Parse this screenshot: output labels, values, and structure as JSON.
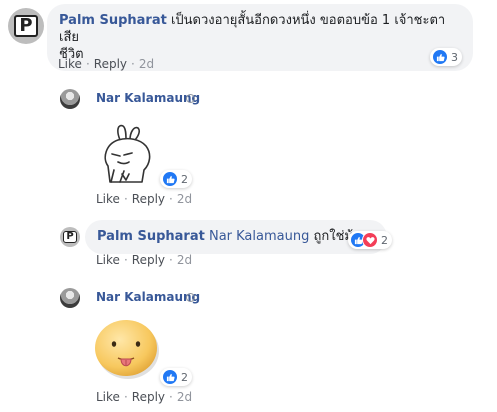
{
  "comments": [
    {
      "author": "Palm Supharat",
      "text_line1": "เป็นดวงอายุสั้นอีกดวงหนึ่ง ขอตอบข้อ 1 เจ้าชะตาเสีย",
      "text_line2": "ชีวิต",
      "like_label": "Like",
      "reply_label": "Reply",
      "time": "2d",
      "reaction_count": "3",
      "reactions": [
        "like-icon"
      ]
    },
    {
      "author": "Nar Kalamaung",
      "sticker": "rabbit-sticker",
      "like_label": "Like",
      "reply_label": "Reply",
      "time": "2d",
      "reaction_count": "2",
      "reactions": [
        "like-icon"
      ]
    },
    {
      "author": "Palm Supharat",
      "mention": "Nar Kalamaung",
      "text": "ถูกใช่ม้าาา",
      "like_label": "Like",
      "reply_label": "Reply",
      "time": "2d",
      "reaction_count": "2",
      "reactions": [
        "like-icon",
        "love-icon"
      ]
    },
    {
      "author": "Nar Kalamaung",
      "sticker": "tongue-out-face-sticker",
      "like_label": "Like",
      "reply_label": "Reply",
      "time": "2d",
      "reaction_count": "2",
      "reactions": [
        "like-icon"
      ]
    }
  ],
  "colors": {
    "author": "#385898",
    "bubble": "#f2f3f5",
    "like": "#2078f4",
    "love": "#f33e58",
    "meta": "#90949c"
  }
}
